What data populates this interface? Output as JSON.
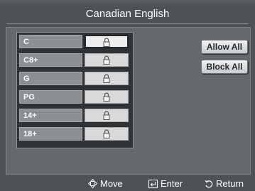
{
  "header": {
    "title": "Canadian English"
  },
  "ratings": [
    {
      "label": "C",
      "locked": true,
      "selected": true
    },
    {
      "label": "C8+",
      "locked": true,
      "selected": false
    },
    {
      "label": "G",
      "locked": true,
      "selected": false
    },
    {
      "label": "PG",
      "locked": true,
      "selected": false
    },
    {
      "label": "14+",
      "locked": true,
      "selected": false
    },
    {
      "label": "18+",
      "locked": true,
      "selected": false
    }
  ],
  "buttons": {
    "allow_all": "Allow All",
    "block_all": "Block All"
  },
  "footer": {
    "move": "Move",
    "enter": "Enter",
    "return": "Return"
  },
  "icons": {
    "lock": "lock-icon",
    "move": "move-dpad-icon",
    "enter": "enter-icon",
    "return": "return-icon"
  },
  "colors": {
    "background": "#4c5256",
    "panel": "#65696c",
    "rating_cell": "#8b9094",
    "lock_cell": "#d9d9d9",
    "button": "#e6e7e8"
  }
}
